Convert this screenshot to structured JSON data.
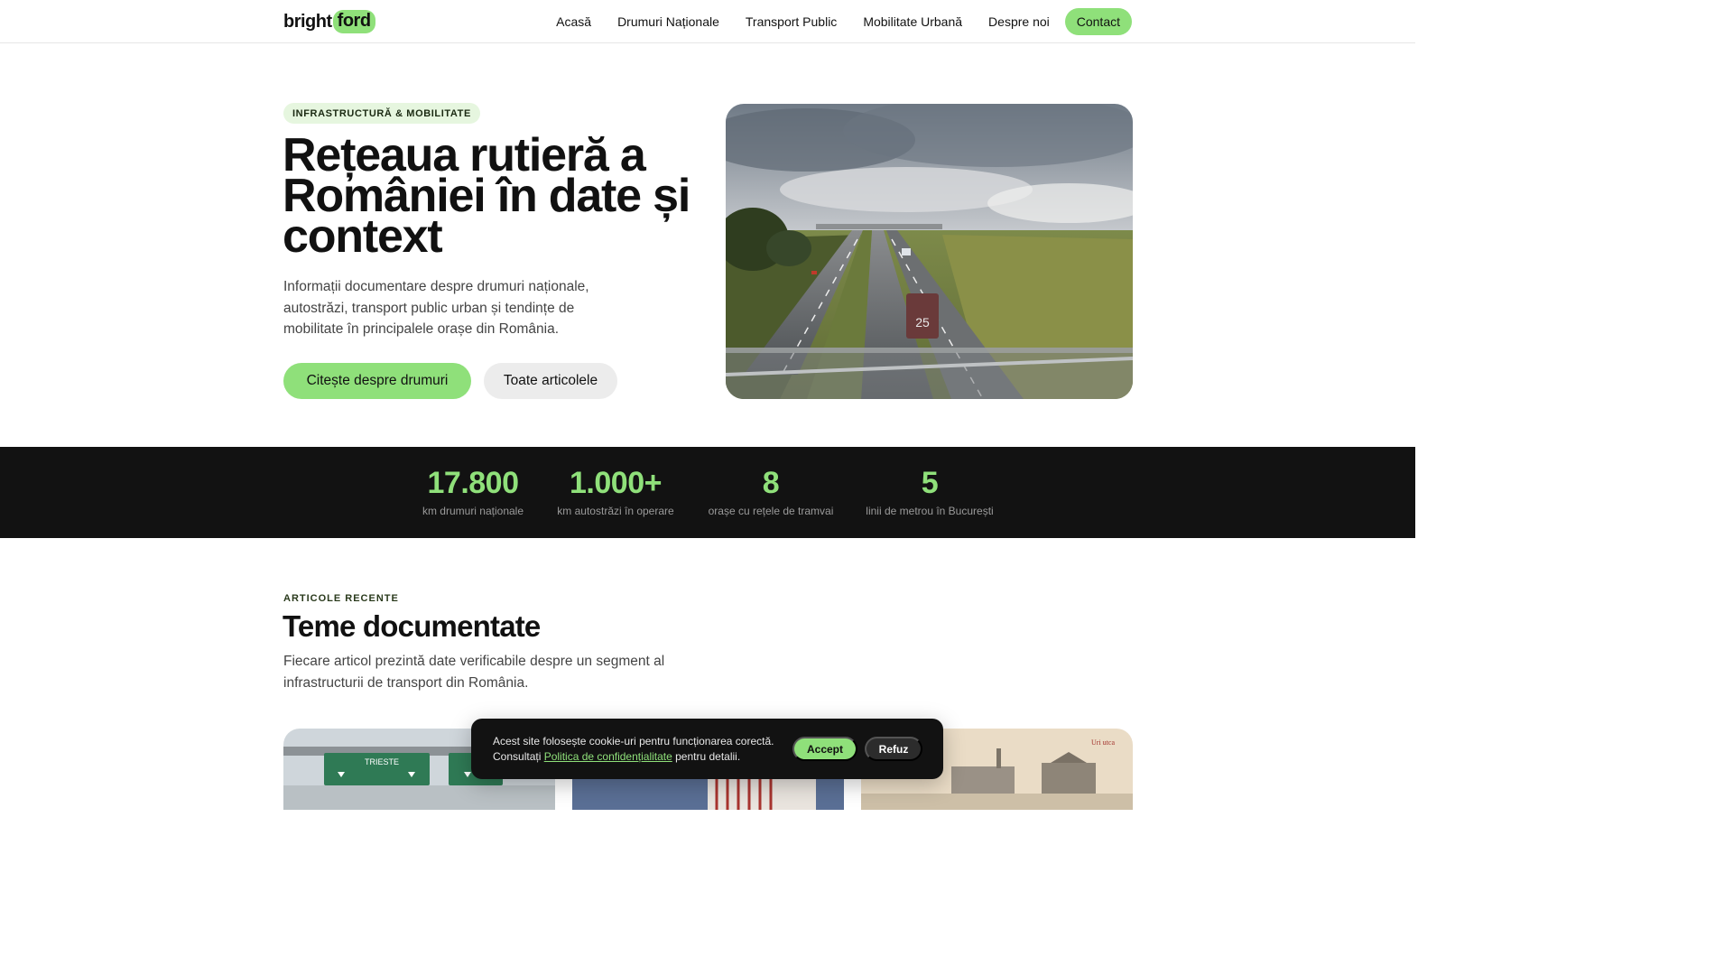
{
  "nav": {
    "logo_part1": "bright",
    "logo_part2": "ford",
    "links": [
      "Acasă",
      "Drumuri Naționale",
      "Transport Public",
      "Mobilitate Urbană",
      "Despre noi"
    ],
    "contact": "Contact"
  },
  "hero": {
    "tag": "INFRASTRUCTURĂ & MOBILITATE",
    "title": "Rețeaua rutieră a României în date și context",
    "description": "Informații documentare despre drumuri naționale, autostrăzi, transport public urban și tendințe de mobilitate în principalele orașe din România.",
    "primary_button": "Citește despre drumuri",
    "secondary_button": "Toate articolele",
    "image_icon": "highway-photo"
  },
  "stats": [
    {
      "number": "17.800",
      "label": "km drumuri naționale"
    },
    {
      "number": "1.000+",
      "label": "km autostrăzi în operare"
    },
    {
      "number": "8",
      "label": "orașe cu rețele de tramvai"
    },
    {
      "number": "5",
      "label": "linii de metrou în București"
    }
  ],
  "articles": {
    "eyebrow": "ARTICOLE RECENTE",
    "title": "Teme documentate",
    "description": "Fiecare articol prezintă date verificabile despre un segment al infrastructurii de transport din România.",
    "card_sign_text": "TRIESTE",
    "card_postcard_text": "Uri utca"
  },
  "cookie": {
    "text_before": "Acest site folosește cookie-uri pentru funcționarea corectă. Consultați ",
    "link": "Politica de confidențialitate",
    "text_after": " pentru detalii.",
    "accept": "Accept",
    "refuse": "Refuz"
  },
  "colors": {
    "accent": "#8fe07a",
    "dark": "#121212"
  }
}
